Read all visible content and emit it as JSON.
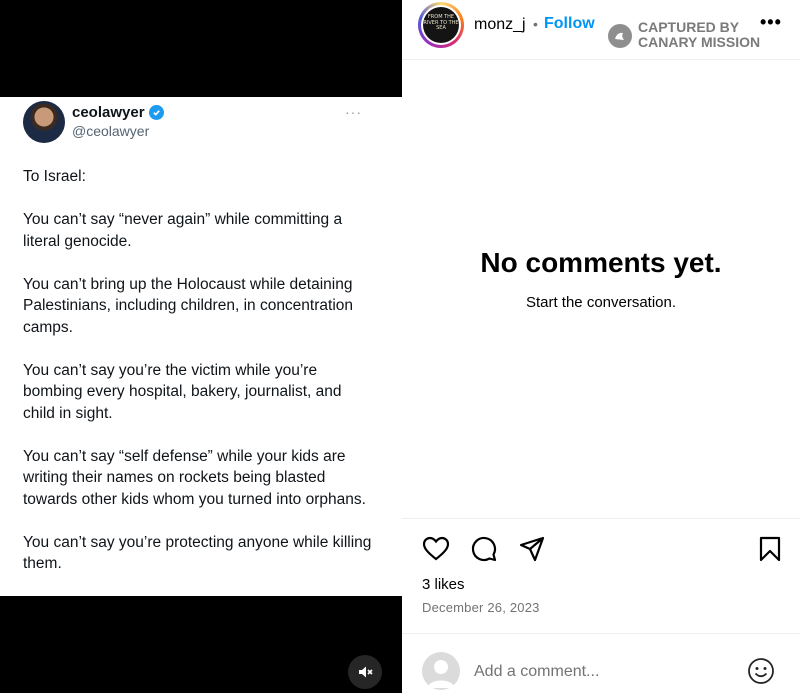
{
  "tweet": {
    "name": "ceolawyer",
    "handle": "@ceolawyer",
    "more": "···",
    "paragraphs": [
      "To Israel:",
      "You can’t say “never again” while committing a literal genocide.",
      "You can’t bring up the Holocaust while detaining Palestinians, including children, in concentration camps.",
      "You can’t say you’re the victim while you’re bombing every hospital, bakery, journalist, and child in sight.",
      "You can’t say “self defense” while your kids are writing their names on rockets being blasted towards other kids whom you turned into orphans.",
      "You can’t say you’re protecting anyone while killing them."
    ]
  },
  "post": {
    "username": "monz_j",
    "separator": "•",
    "follow_label": "Follow",
    "watermark_line1": "CAPTURED BY",
    "watermark_line2": "CANARY MISSION",
    "more": "•••",
    "empty_title": "No comments yet.",
    "empty_subtitle": "Start the conversation.",
    "likes": "3 likes",
    "date": "December 26, 2023",
    "comment_placeholder": "Add a comment..."
  },
  "story_image_text": "FROM THE RIVER TO THE SEA",
  "colors": {
    "accent": "#0095f6",
    "verified": "#1d9bf0",
    "muted": "#737373"
  },
  "icons": [
    "mute-icon",
    "heart-icon",
    "comment-icon",
    "share-icon",
    "bookmark-icon",
    "emoji-icon",
    "verified-icon"
  ]
}
